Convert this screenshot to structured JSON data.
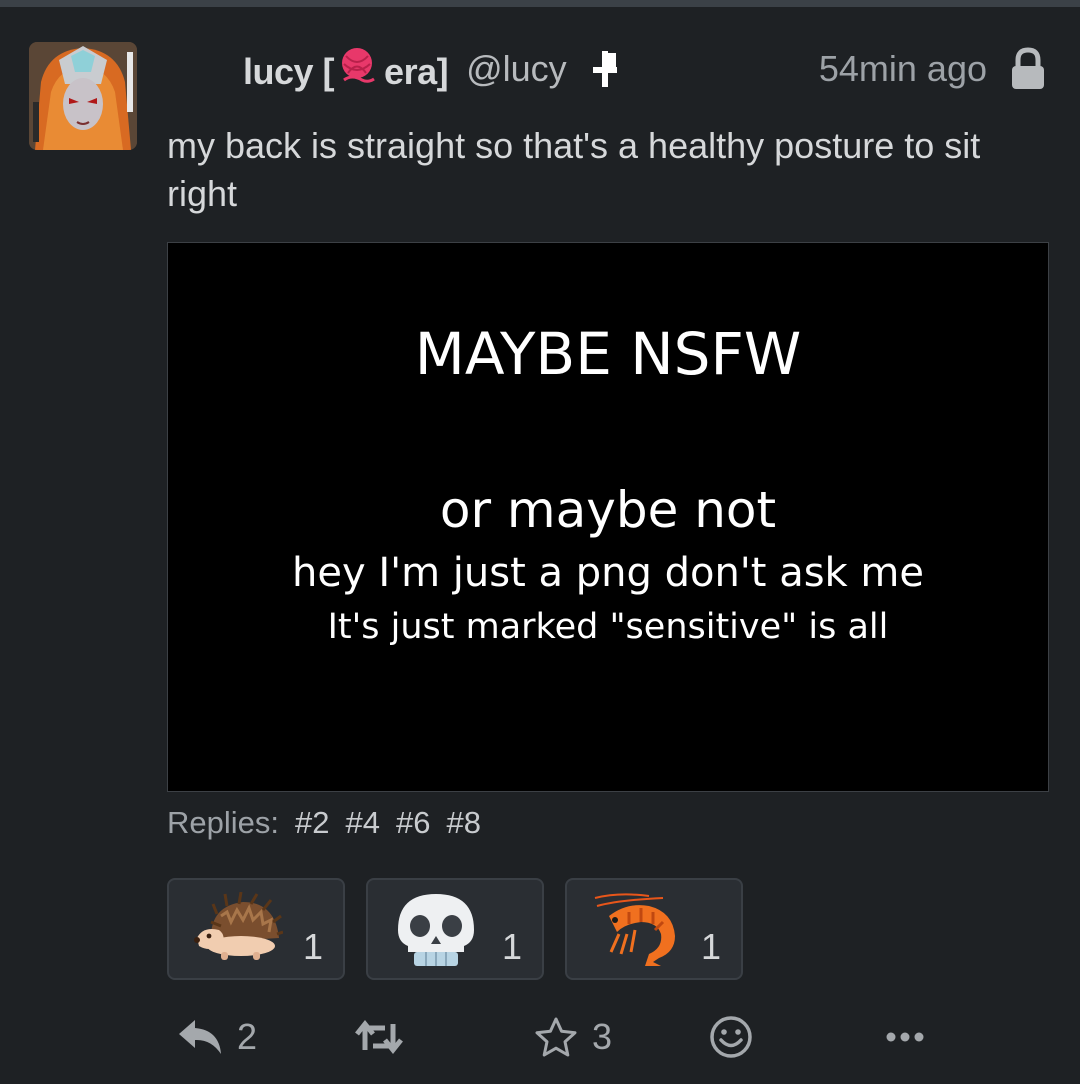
{
  "post": {
    "author": {
      "display_name_prefix": "lucy [",
      "display_name_suffix": "era]",
      "handle": "@lucy"
    },
    "timestamp": "54min ago",
    "visibility_icon": "lock-icon",
    "text": "my back is straight so that's a healthy posture to sit right",
    "attachment": {
      "title": "MAYBE NSFW",
      "line1": "or maybe not",
      "line2": "hey I'm just a png don't ask me",
      "line3": "It's just marked \"sensitive\" is all"
    },
    "replies_label": "Replies:",
    "replies": [
      "#2",
      "#4",
      "#6",
      "#8"
    ],
    "reactions": [
      {
        "emoji": "hedgehog",
        "count": "1"
      },
      {
        "emoji": "skull",
        "count": "1"
      },
      {
        "emoji": "shrimp",
        "count": "1"
      }
    ],
    "actions": {
      "reply_count": "2",
      "favorite_count": "3"
    }
  }
}
